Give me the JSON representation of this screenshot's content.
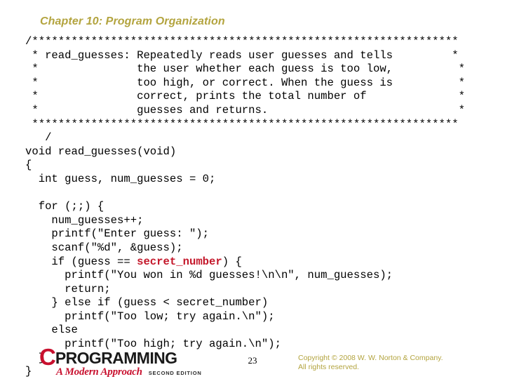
{
  "slide": {
    "title": "Chapter 10: Program Organization",
    "title_color": "#b3a43f",
    "background_color": "#ffffff"
  },
  "code": {
    "highlight_color": "#c4182b",
    "text_color": "#000000",
    "lines": [
      {
        "text": "/*****************************************************************"
      },
      {
        "text": " * read_guesses: Repeatedly reads user guesses and tells         *"
      },
      {
        "text": " *               the user whether each guess is too low,          *"
      },
      {
        "text": " *               too high, or correct. When the guess is          *"
      },
      {
        "text": " *               correct, prints the total number of              *"
      },
      {
        "text": " *               guesses and returns.                             *"
      },
      {
        "text": " *****************************************************************"
      },
      {
        "text": "   /"
      },
      {
        "text": "void read_guesses(void)"
      },
      {
        "text": "{"
      },
      {
        "text": "  int guess, num_guesses = 0;"
      },
      {
        "text": ""
      },
      {
        "text": "  for (;;) {"
      },
      {
        "text": "    num_guesses++;"
      },
      {
        "text": "    printf(\"Enter guess: \");"
      },
      {
        "text": "    scanf(\"%d\", &guess);"
      },
      {
        "pre": "    if (guess == ",
        "highlight": "secret_number",
        "post": ") {"
      },
      {
        "text": "      printf(\"You won in %d guesses!\\n\\n\", num_guesses);"
      },
      {
        "text": "      return;"
      },
      {
        "text": "    } else if (guess < secret_number)"
      },
      {
        "text": "      printf(\"Too low; try again.\\n\");"
      },
      {
        "text": "    else"
      },
      {
        "text": "      printf(\"Too high; try again.\\n\");"
      },
      {
        "text": "  }"
      },
      {
        "text": "}"
      }
    ]
  },
  "footer": {
    "logo": {
      "initial": "C",
      "word": "PROGRAMMING",
      "tagline": "A Modern Approach",
      "edition": "SECOND EDITION",
      "initial_color": "#c8102e",
      "word_color": "#1a1a1a"
    },
    "page_number": "23",
    "copyright_line1": "Copyright © 2008 W. W. Norton & Company.",
    "copyright_line2": "All rights reserved.",
    "copyright_color": "#b3a43f"
  }
}
